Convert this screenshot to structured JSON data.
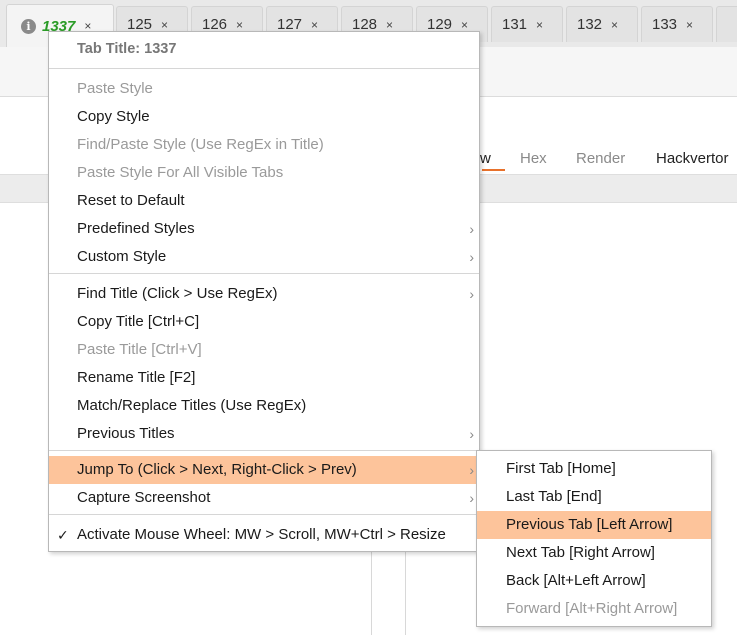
{
  "tabs": {
    "active": {
      "label": "1337",
      "close": "×",
      "icon": "info-icon"
    },
    "others": [
      {
        "label": "125",
        "close": "×"
      },
      {
        "label": "126",
        "close": "×"
      },
      {
        "label": "127",
        "close": "×"
      },
      {
        "label": "128",
        "close": "×"
      },
      {
        "label": "129",
        "close": "×"
      },
      {
        "label": "131",
        "close": "×"
      },
      {
        "label": "132",
        "close": "×"
      },
      {
        "label": "133",
        "close": "×"
      }
    ]
  },
  "subtabs": [
    "w",
    "Hex",
    "Render",
    "Hackvertor"
  ],
  "menu": {
    "header": "Tab Title: 1337",
    "group1": [
      {
        "label": "Paste Style",
        "disabled": true
      },
      {
        "label": "Copy Style"
      },
      {
        "label": "Find/Paste Style (Use RegEx in Title)",
        "disabled": true
      },
      {
        "label": "Paste Style For All Visible Tabs",
        "disabled": true
      },
      {
        "label": "Reset to Default"
      },
      {
        "label": "Predefined Styles",
        "submenu": true
      },
      {
        "label": "Custom Style",
        "submenu": true
      }
    ],
    "group2": [
      {
        "label": "Find Title (Click > Use RegEx)",
        "submenu": true
      },
      {
        "label": "Copy Title [Ctrl+C]"
      },
      {
        "label": "Paste Title [Ctrl+V]",
        "disabled": true
      },
      {
        "label": "Rename Title [F2]"
      },
      {
        "label": "Match/Replace Titles (Use RegEx)"
      },
      {
        "label": "Previous Titles",
        "submenu": true
      }
    ],
    "group3": [
      {
        "label": "Jump To (Click > Next, Right-Click > Prev)",
        "submenu": true,
        "highlighted": true
      },
      {
        "label": "Capture Screenshot",
        "submenu": true
      }
    ],
    "group4": [
      {
        "label": "Activate Mouse Wheel: MW > Scroll, MW+Ctrl > Resize",
        "checked": true,
        "check_mark": "✓"
      }
    ],
    "submenu_arrow": "›"
  },
  "jump_submenu": [
    {
      "label": "First Tab [Home]"
    },
    {
      "label": "Last Tab [End]"
    },
    {
      "label": "Previous Tab [Left Arrow]",
      "highlighted": true
    },
    {
      "label": "Next Tab [Right Arrow]"
    },
    {
      "label": "Back [Alt+Left Arrow]"
    },
    {
      "label": "Forward [Alt+Right Arrow]",
      "disabled": true
    }
  ],
  "colors": {
    "active_tab_text": "#2a9b26",
    "highlight": "#fdc49b",
    "accent_underline": "#e8712b"
  }
}
